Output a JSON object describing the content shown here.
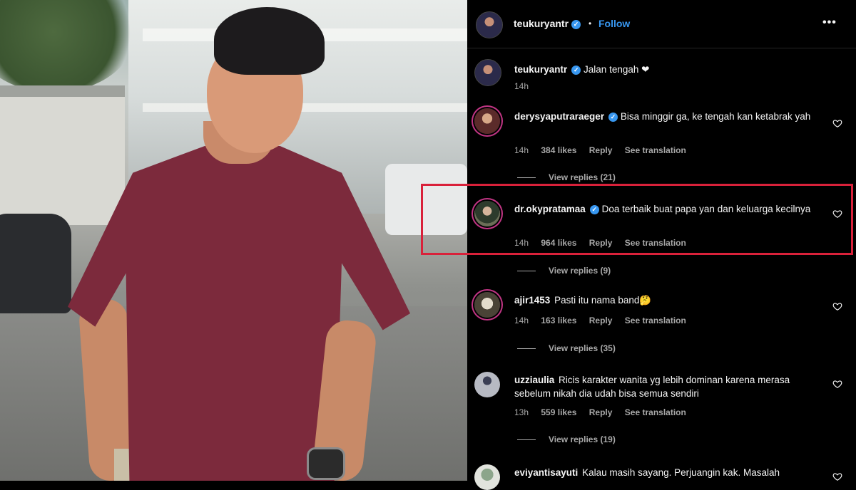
{
  "post": {
    "username": "teukuryantr",
    "separator": "•",
    "follow_label": "Follow",
    "more_label": "•••"
  },
  "caption": {
    "username": "teukuryantr",
    "text": "Jalan tengah ❤",
    "time": "14h"
  },
  "comments": [
    {
      "username": "derysyaputraraeger",
      "verified": true,
      "text": "Bisa minggir ga, ke tengah kan ketabrak yah",
      "time": "14h",
      "likes": "384 likes",
      "reply": "Reply",
      "translate": "See translation",
      "view_replies": "View replies (21)"
    },
    {
      "username": "dr.okypratamaa",
      "verified": true,
      "text": "Doa terbaik buat papa yan dan keluarga kecilnya",
      "time": "14h",
      "likes": "964 likes",
      "reply": "Reply",
      "translate": "See translation",
      "view_replies": "View replies (9)"
    },
    {
      "username": "ajir1453",
      "verified": false,
      "text": "Pasti itu nama band🤔",
      "time": "14h",
      "likes": "163 likes",
      "reply": "Reply",
      "translate": "See translation",
      "view_replies": "View replies (35)"
    },
    {
      "username": "uzziaulia",
      "verified": false,
      "text": "Ricis karakter wanita yg lebih dominan karena merasa sebelum nikah dia udah bisa semua sendiri",
      "time": "13h",
      "likes": "559 likes",
      "reply": "Reply",
      "translate": "See translation",
      "view_replies": "View replies (19)"
    },
    {
      "username": "eviyantisayuti",
      "verified": false,
      "text": "Kalau masih sayang. Perjuangin kak. Masalah",
      "time": "",
      "likes": "",
      "reply": "",
      "translate": "",
      "view_replies": ""
    }
  ],
  "colors": {
    "accent": "#3897f0",
    "highlight": "#d9213a",
    "background": "#000000"
  }
}
